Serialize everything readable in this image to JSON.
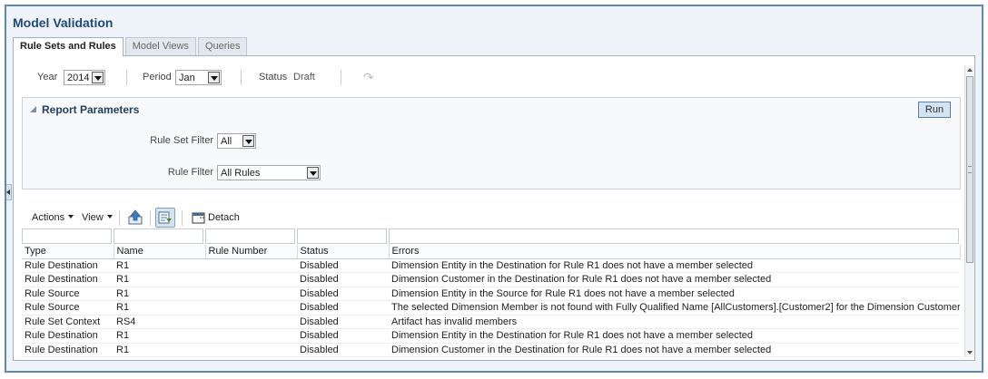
{
  "page": {
    "title": "Model Validation"
  },
  "tabs": [
    {
      "label": "Rule Sets and Rules",
      "active": true
    },
    {
      "label": "Model Views",
      "active": false
    },
    {
      "label": "Queries",
      "active": false
    }
  ],
  "toolbar": {
    "year_label": "Year",
    "year_value": "2014",
    "period_label": "Period",
    "period_value": "Jan",
    "status_label": "Status",
    "status_value": "Draft",
    "redo_icon": "redo-icon"
  },
  "report_parameters": {
    "title": "Report Parameters",
    "run_label": "Run",
    "rule_set_filter_label": "Rule Set Filter",
    "rule_set_filter_value": "All",
    "rule_filter_label": "Rule Filter",
    "rule_filter_value": "All Rules"
  },
  "table_toolbar": {
    "actions_label": "Actions",
    "view_label": "View",
    "detach_label": "Detach",
    "icons": [
      "export-icon",
      "query-by-example-icon",
      "detach-icon"
    ]
  },
  "table": {
    "columns": [
      "Type",
      "Name",
      "Rule Number",
      "Status",
      "Errors"
    ],
    "rows": [
      [
        "Rule Destination",
        "R1",
        "",
        "Disabled",
        "Dimension Entity in the Destination for Rule R1 does not have a member selected"
      ],
      [
        "Rule Destination",
        "R1",
        "",
        "Disabled",
        "Dimension Customer in the Destination for Rule R1 does not have a member selected"
      ],
      [
        "Rule Source",
        "R1",
        "",
        "Disabled",
        "Dimension Entity in the Source for Rule R1 does not have a member selected"
      ],
      [
        "Rule Source",
        "R1",
        "",
        "Disabled",
        "The selected Dimension Member is not found with Fully Qualified Name [AllCustomers].[Customer2] for the Dimension Customer"
      ],
      [
        "Rule Set Context",
        "RS4",
        "",
        "Disabled",
        "Artifact has invalid members"
      ],
      [
        "Rule Destination",
        "R1",
        "",
        "Disabled",
        "Dimension Entity in the Destination for Rule R1 does not have a member selected"
      ],
      [
        "Rule Destination",
        "R1",
        "",
        "Disabled",
        "Dimension Customer in the Destination for Rule R1 does not have a member selected"
      ]
    ]
  }
}
